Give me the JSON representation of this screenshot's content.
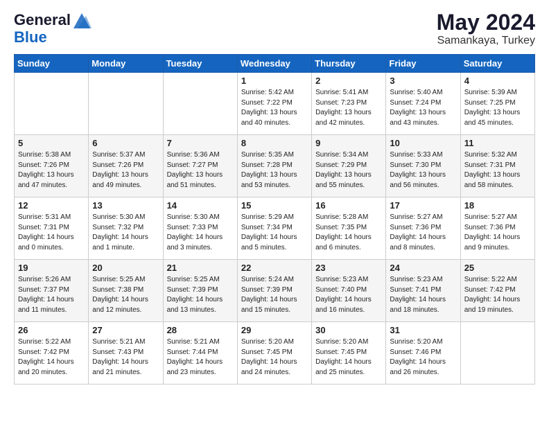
{
  "header": {
    "logo_general": "General",
    "logo_blue": "Blue",
    "month_year": "May 2024",
    "location": "Samankaya, Turkey"
  },
  "days_of_week": [
    "Sunday",
    "Monday",
    "Tuesday",
    "Wednesday",
    "Thursday",
    "Friday",
    "Saturday"
  ],
  "weeks": [
    [
      {
        "day": "",
        "info": ""
      },
      {
        "day": "",
        "info": ""
      },
      {
        "day": "",
        "info": ""
      },
      {
        "day": "1",
        "info": "Sunrise: 5:42 AM\nSunset: 7:22 PM\nDaylight: 13 hours\nand 40 minutes."
      },
      {
        "day": "2",
        "info": "Sunrise: 5:41 AM\nSunset: 7:23 PM\nDaylight: 13 hours\nand 42 minutes."
      },
      {
        "day": "3",
        "info": "Sunrise: 5:40 AM\nSunset: 7:24 PM\nDaylight: 13 hours\nand 43 minutes."
      },
      {
        "day": "4",
        "info": "Sunrise: 5:39 AM\nSunset: 7:25 PM\nDaylight: 13 hours\nand 45 minutes."
      }
    ],
    [
      {
        "day": "5",
        "info": "Sunrise: 5:38 AM\nSunset: 7:26 PM\nDaylight: 13 hours\nand 47 minutes."
      },
      {
        "day": "6",
        "info": "Sunrise: 5:37 AM\nSunset: 7:26 PM\nDaylight: 13 hours\nand 49 minutes."
      },
      {
        "day": "7",
        "info": "Sunrise: 5:36 AM\nSunset: 7:27 PM\nDaylight: 13 hours\nand 51 minutes."
      },
      {
        "day": "8",
        "info": "Sunrise: 5:35 AM\nSunset: 7:28 PM\nDaylight: 13 hours\nand 53 minutes."
      },
      {
        "day": "9",
        "info": "Sunrise: 5:34 AM\nSunset: 7:29 PM\nDaylight: 13 hours\nand 55 minutes."
      },
      {
        "day": "10",
        "info": "Sunrise: 5:33 AM\nSunset: 7:30 PM\nDaylight: 13 hours\nand 56 minutes."
      },
      {
        "day": "11",
        "info": "Sunrise: 5:32 AM\nSunset: 7:31 PM\nDaylight: 13 hours\nand 58 minutes."
      }
    ],
    [
      {
        "day": "12",
        "info": "Sunrise: 5:31 AM\nSunset: 7:31 PM\nDaylight: 14 hours\nand 0 minutes."
      },
      {
        "day": "13",
        "info": "Sunrise: 5:30 AM\nSunset: 7:32 PM\nDaylight: 14 hours\nand 1 minute."
      },
      {
        "day": "14",
        "info": "Sunrise: 5:30 AM\nSunset: 7:33 PM\nDaylight: 14 hours\nand 3 minutes."
      },
      {
        "day": "15",
        "info": "Sunrise: 5:29 AM\nSunset: 7:34 PM\nDaylight: 14 hours\nand 5 minutes."
      },
      {
        "day": "16",
        "info": "Sunrise: 5:28 AM\nSunset: 7:35 PM\nDaylight: 14 hours\nand 6 minutes."
      },
      {
        "day": "17",
        "info": "Sunrise: 5:27 AM\nSunset: 7:36 PM\nDaylight: 14 hours\nand 8 minutes."
      },
      {
        "day": "18",
        "info": "Sunrise: 5:27 AM\nSunset: 7:36 PM\nDaylight: 14 hours\nand 9 minutes."
      }
    ],
    [
      {
        "day": "19",
        "info": "Sunrise: 5:26 AM\nSunset: 7:37 PM\nDaylight: 14 hours\nand 11 minutes."
      },
      {
        "day": "20",
        "info": "Sunrise: 5:25 AM\nSunset: 7:38 PM\nDaylight: 14 hours\nand 12 minutes."
      },
      {
        "day": "21",
        "info": "Sunrise: 5:25 AM\nSunset: 7:39 PM\nDaylight: 14 hours\nand 13 minutes."
      },
      {
        "day": "22",
        "info": "Sunrise: 5:24 AM\nSunset: 7:39 PM\nDaylight: 14 hours\nand 15 minutes."
      },
      {
        "day": "23",
        "info": "Sunrise: 5:23 AM\nSunset: 7:40 PM\nDaylight: 14 hours\nand 16 minutes."
      },
      {
        "day": "24",
        "info": "Sunrise: 5:23 AM\nSunset: 7:41 PM\nDaylight: 14 hours\nand 18 minutes."
      },
      {
        "day": "25",
        "info": "Sunrise: 5:22 AM\nSunset: 7:42 PM\nDaylight: 14 hours\nand 19 minutes."
      }
    ],
    [
      {
        "day": "26",
        "info": "Sunrise: 5:22 AM\nSunset: 7:42 PM\nDaylight: 14 hours\nand 20 minutes."
      },
      {
        "day": "27",
        "info": "Sunrise: 5:21 AM\nSunset: 7:43 PM\nDaylight: 14 hours\nand 21 minutes."
      },
      {
        "day": "28",
        "info": "Sunrise: 5:21 AM\nSunset: 7:44 PM\nDaylight: 14 hours\nand 23 minutes."
      },
      {
        "day": "29",
        "info": "Sunrise: 5:20 AM\nSunset: 7:45 PM\nDaylight: 14 hours\nand 24 minutes."
      },
      {
        "day": "30",
        "info": "Sunrise: 5:20 AM\nSunset: 7:45 PM\nDaylight: 14 hours\nand 25 minutes."
      },
      {
        "day": "31",
        "info": "Sunrise: 5:20 AM\nSunset: 7:46 PM\nDaylight: 14 hours\nand 26 minutes."
      },
      {
        "day": "",
        "info": ""
      }
    ]
  ]
}
